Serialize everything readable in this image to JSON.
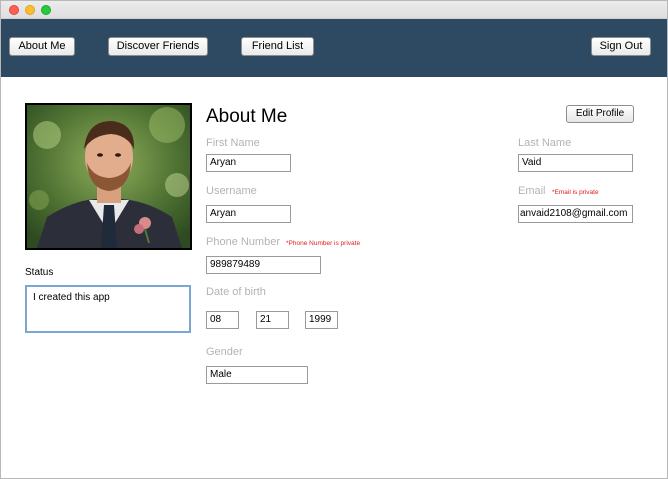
{
  "nav": {
    "about_me": "About Me",
    "discover_friends": "Discover Friends",
    "friend_list": "Friend List",
    "sign_out": "Sign Out"
  },
  "profile": {
    "status_label": "Status",
    "status_text": "I created this app",
    "title": "About Me",
    "edit_label": "Edit Profile",
    "first_name_label": "First Name",
    "first_name": "Aryan",
    "last_name_label": "Last Name",
    "last_name": "Vaid",
    "username_label": "Username",
    "username": "Aryan",
    "email_label": "Email",
    "email_private": "*Email is private",
    "email": "anvaid2108@gmail.com",
    "phone_label": "Phone Number",
    "phone_private": "*Phone Number is private",
    "phone": "989879489",
    "dob_label": "Date of birth",
    "dob_month": "08",
    "dob_day": "21",
    "dob_year": "1999",
    "gender_label": "Gender",
    "gender": "Male"
  },
  "colors": {
    "navbar": "#2e4a62",
    "private_note": "#e02020",
    "label": "#b3b3b3",
    "status_border": "#7aa6d0"
  }
}
